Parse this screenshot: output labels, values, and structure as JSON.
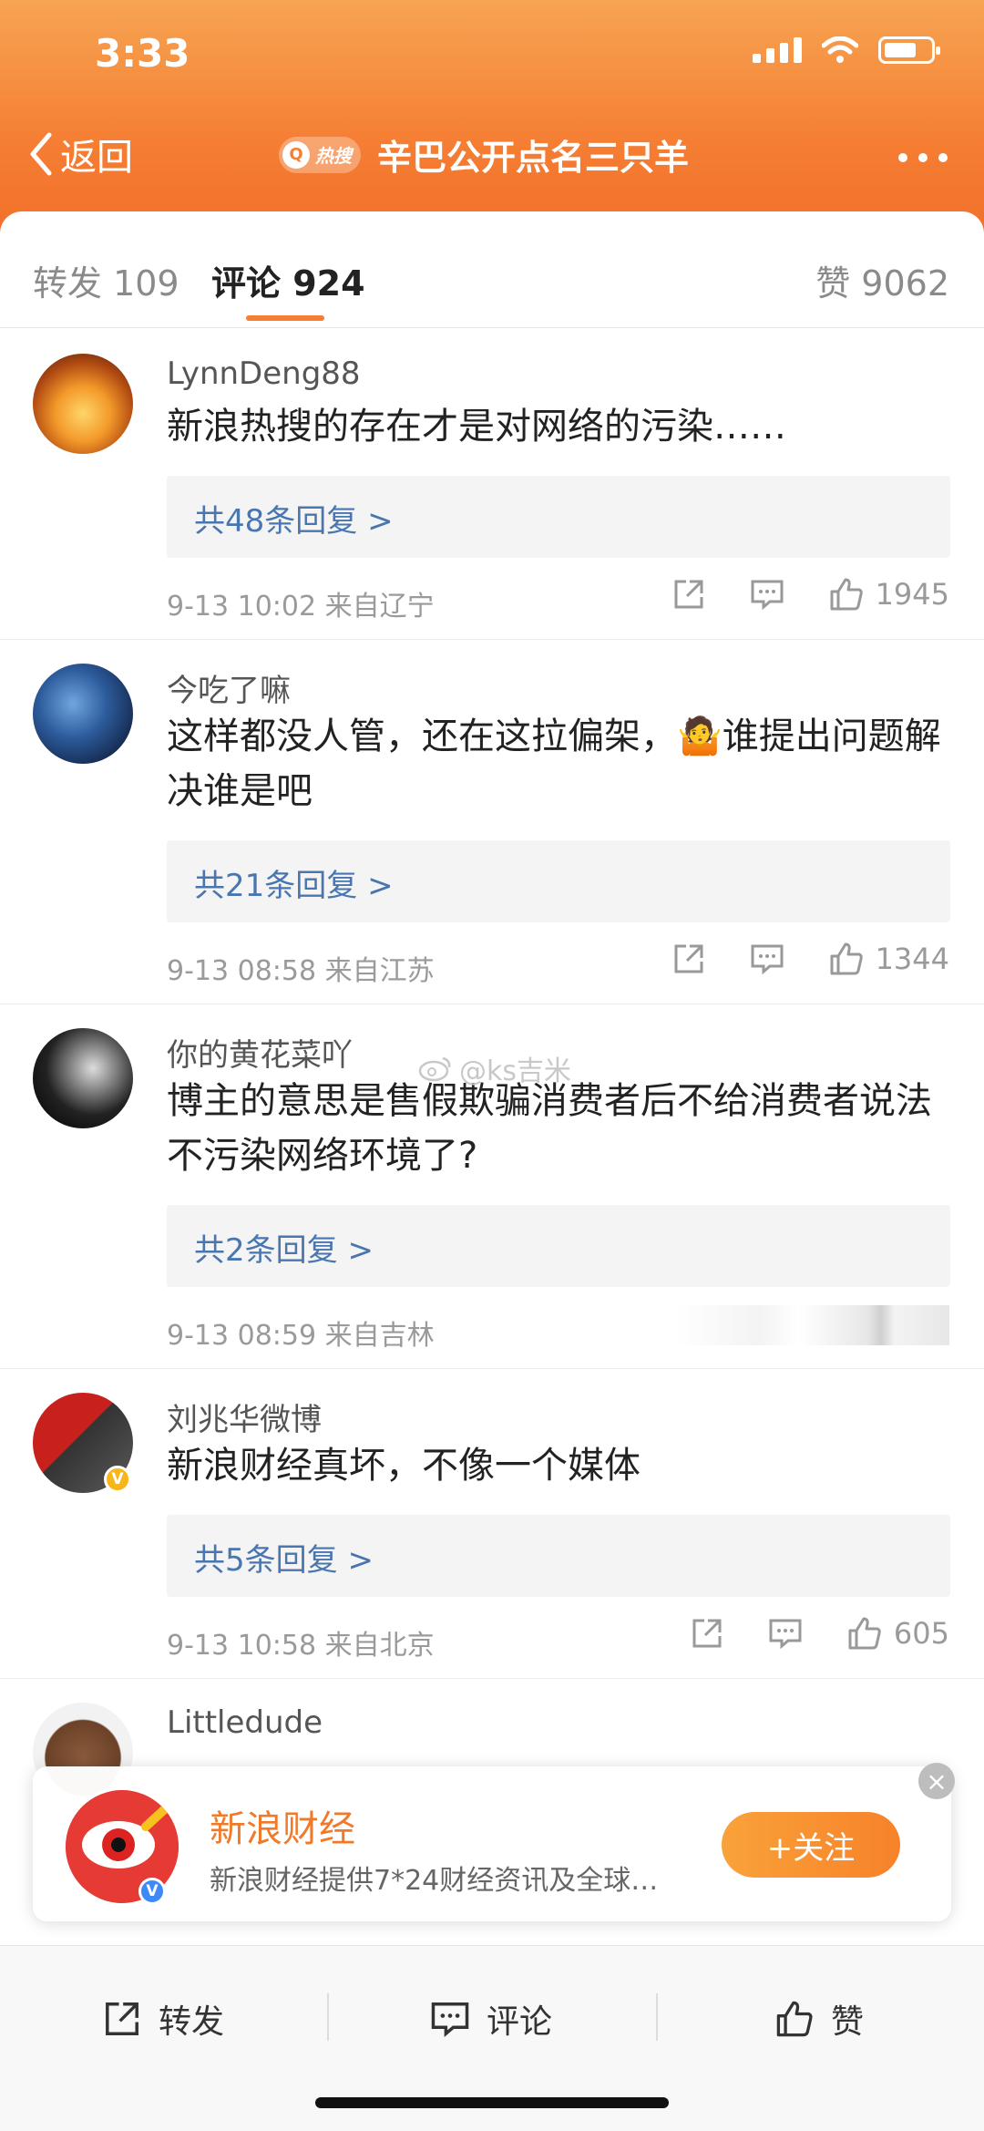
{
  "status": {
    "time": "3:33"
  },
  "nav": {
    "back_label": "返回",
    "hot_badge": "热搜",
    "title": "辛巴公开点名三只羊"
  },
  "tabs": {
    "repost": "转发 109",
    "comment": "评论 924",
    "like": "赞 9062"
  },
  "comments": [
    {
      "user": "LynnDeng88",
      "text": "新浪热搜的存在才是对网络的污染……",
      "replies": "共48条回复 >",
      "time": "9-13 10:02",
      "location": "来自辽宁",
      "likes": "1945"
    },
    {
      "user": "今吃了嘛",
      "text": "这样都没人管，还在这拉偏架，🤷谁提出问题解决谁是吧",
      "replies": "共21条回复 >",
      "time": "9-13 08:58",
      "location": "来自江苏",
      "likes": "1344"
    },
    {
      "user": "你的黄花菜吖",
      "text": "博主的意思是售假欺骗消费者后不给消费者说法不污染网络环境了?",
      "replies": "共2条回复 >",
      "time": "9-13 08:59",
      "location": "来自吉林",
      "likes": ""
    },
    {
      "user": "刘兆华微博",
      "text": "新浪财经真坏，不像一个媒体",
      "replies": "共5条回复 >",
      "time": "9-13 10:58",
      "location": "来自北京",
      "likes": "605"
    },
    {
      "user": "Littledude",
      "text": "",
      "replies": "",
      "time": "",
      "location": "",
      "likes": ""
    }
  ],
  "watermark": "@ks吉米",
  "popup": {
    "title": "新浪财经",
    "desc": "新浪财经提供7*24财经资讯及全球…",
    "follow": "+关注"
  },
  "bottombar": {
    "repost": "转发",
    "comment": "评论",
    "like": "赞"
  },
  "colors": {
    "accent": "#f57e33",
    "link": "#4a76b0"
  }
}
